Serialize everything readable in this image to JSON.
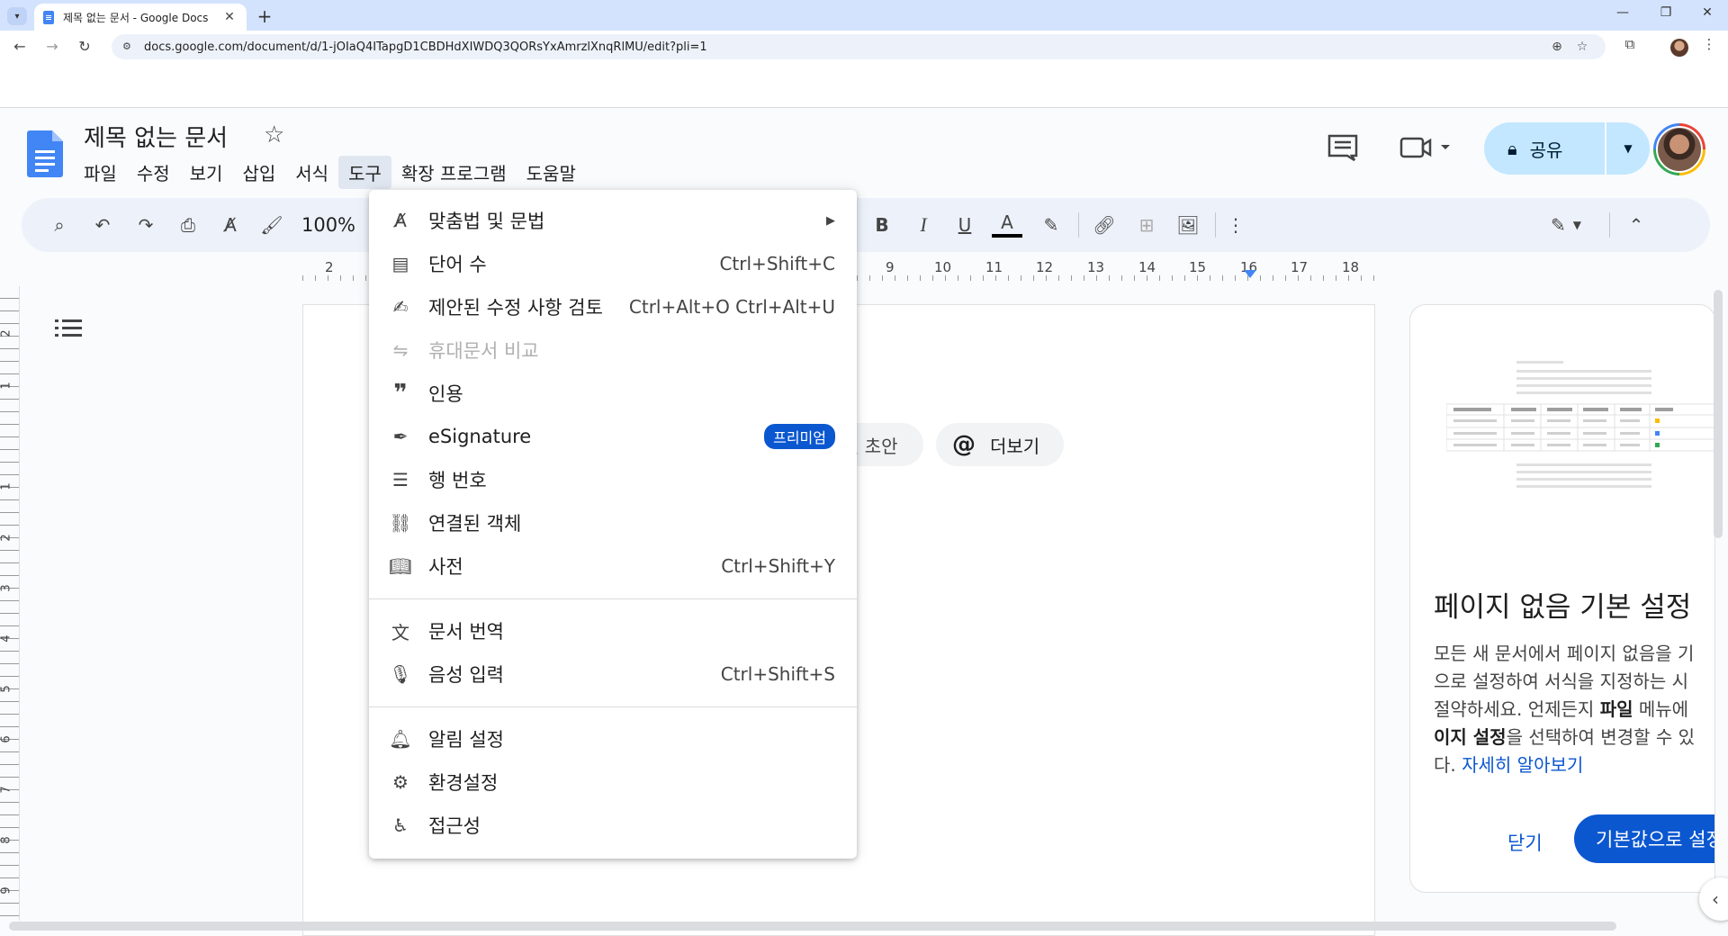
{
  "browser": {
    "tab_title": "제목 없는 문서 - Google Docs",
    "url": "docs.google.com/document/d/1-jOIaQ4ITapgD1CBDHdXIWDQ3QORsYxAmrzlXnqRlMU/edit?pli=1"
  },
  "docs": {
    "title": "제목 없는 문서",
    "menus": [
      "파일",
      "수정",
      "보기",
      "삽입",
      "서식",
      "도구",
      "확장 프로그램",
      "도움말"
    ],
    "active_menu": "도구",
    "share_label": "공유"
  },
  "toolbar": {
    "zoom": "100%",
    "bold_label": "B",
    "italic_label": "I",
    "underline_label": "U",
    "text_color_label": "A"
  },
  "ruler": {
    "numbers": [
      "2",
      "9",
      "10",
      "11",
      "12",
      "13",
      "14",
      "15",
      "16",
      "17",
      "18"
    ],
    "vertical_numbers": [
      "2",
      "1",
      "1",
      "2",
      "3",
      "4",
      "5",
      "6",
      "7",
      "8",
      "9"
    ]
  },
  "page_chips": {
    "draft_partial": "일 초안",
    "more": "더보기",
    "more_icon": "@"
  },
  "side_panel": {
    "title": "페이지 없음 기본 설정",
    "body_line1": "모든 새 문서에서 페이지 없음을 기",
    "body_line2": "으로 설정하여 서식을 지정하는 시",
    "body_line3_pre": "절약하세요. 언제든지 ",
    "body_line3_bold": "파일",
    "body_line3_post": " 메뉴에",
    "body_line4_bold": "이지 설정",
    "body_line4_post": "을 선택하여 변경할 수 있",
    "body_line5_pre": "다. ",
    "learn_more": "자세히 알아보기",
    "close_label": "닫기",
    "default_label": "기본값으로 설정"
  },
  "tools_menu": {
    "items": [
      {
        "label": "맞춤법 및 문법",
        "shortcut": "",
        "icon": "spellcheck-icon",
        "submenu": true
      },
      {
        "label": "단어 수",
        "shortcut": "Ctrl+Shift+C",
        "icon": "word-count-icon"
      },
      {
        "label": "제안된 수정 사항 검토",
        "shortcut": "Ctrl+Alt+O Ctrl+Alt+U",
        "icon": "review-edits-icon"
      },
      {
        "label": "휴대문서 비교",
        "shortcut": "",
        "icon": "compare-icon",
        "disabled": true
      },
      {
        "label": "인용",
        "shortcut": "",
        "icon": "quote-icon"
      },
      {
        "label": "eSignature",
        "shortcut": "",
        "icon": "signature-icon",
        "badge": "프리미엄"
      },
      {
        "label": "행 번호",
        "shortcut": "",
        "icon": "line-numbers-icon"
      },
      {
        "label": "연결된 객체",
        "shortcut": "",
        "icon": "linked-objects-icon"
      },
      {
        "label": "사전",
        "shortcut": "Ctrl+Shift+Y",
        "icon": "dictionary-icon"
      },
      {
        "label": "문서 번역",
        "shortcut": "",
        "icon": "translate-icon"
      },
      {
        "label": "음성 입력",
        "shortcut": "Ctrl+Shift+S",
        "icon": "mic-icon"
      },
      {
        "label": "알림 설정",
        "shortcut": "",
        "icon": "bell-icon"
      },
      {
        "label": "환경설정",
        "shortcut": "",
        "icon": "preferences-icon"
      },
      {
        "label": "접근성",
        "shortcut": "",
        "icon": "accessibility-icon"
      }
    ]
  },
  "colors": {
    "accent": "#0b57d0",
    "share_bg": "#c2e7ff",
    "toolbar_bg": "#edf2fa",
    "tab_strip": "#d3e3fd",
    "docs_blue": "#4285f4"
  }
}
